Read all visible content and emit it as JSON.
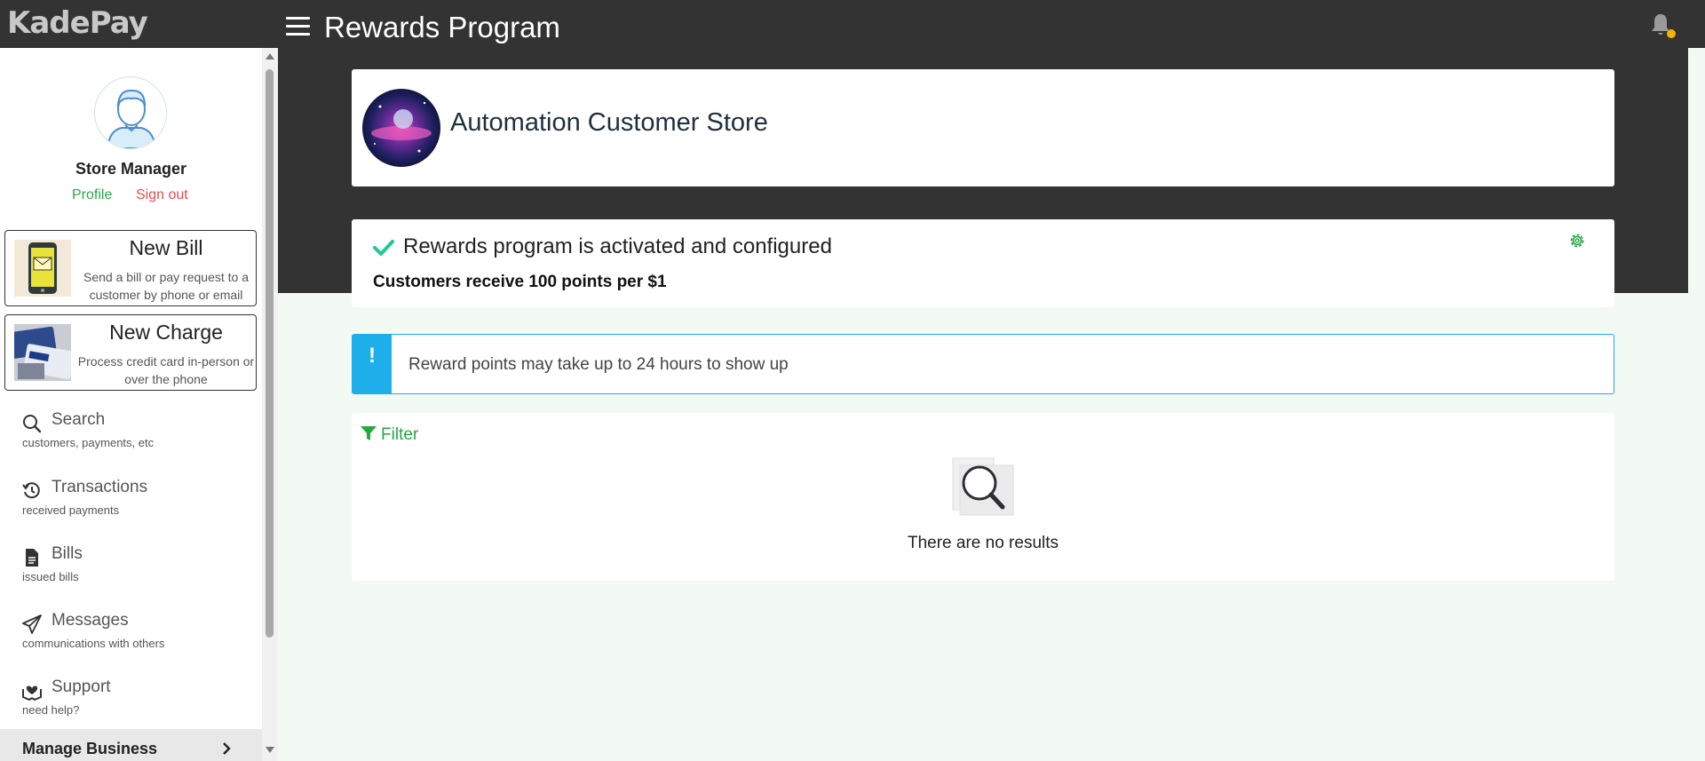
{
  "app": {
    "logo": "KadePay"
  },
  "header": {
    "title": "Rewards Program"
  },
  "sidebar": {
    "user_name": "Store Manager",
    "profile_label": "Profile",
    "signout_label": "Sign out",
    "new_bill": {
      "title": "New Bill",
      "description": "Send a bill or pay request to a customer by phone or email"
    },
    "new_charge": {
      "title": "New Charge",
      "description": "Process credit card in-person or over the phone"
    },
    "nav": [
      {
        "label": "Search",
        "sub": "customers, payments, etc",
        "icon": "search-icon"
      },
      {
        "label": "Transactions",
        "sub": "received payments",
        "icon": "history-icon"
      },
      {
        "label": "Bills",
        "sub": "issued bills",
        "icon": "document-icon"
      },
      {
        "label": "Messages",
        "sub": "communications with others",
        "icon": "paper-plane-icon"
      },
      {
        "label": "Support",
        "sub": "need help?",
        "icon": "support-hands-icon"
      }
    ],
    "manage_business": "Manage Business"
  },
  "store": {
    "name": "Automation Customer Store"
  },
  "rewards": {
    "status": "Rewards program is activated and configured",
    "rate": "Customers receive 100 points per $1"
  },
  "notice": {
    "mark": "!",
    "text": "Reward points may take up to 24 hours to show up"
  },
  "results": {
    "filter_label": "Filter",
    "empty_text": "There are no results"
  },
  "colors": {
    "header_bg": "#333333",
    "accent_green": "#28a745",
    "signout_red": "#e44d4d",
    "info_blue": "#1eaee9",
    "page_bg": "#f3f9f3",
    "notification_dot": "#f5b400"
  }
}
